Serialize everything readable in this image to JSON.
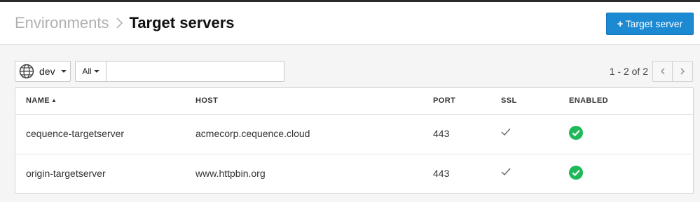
{
  "header": {
    "breadcrumb_parent": "Environments",
    "title": "Target servers",
    "add_button_plus": "+",
    "add_button_label": "Target server"
  },
  "toolbar": {
    "environment": "dev",
    "filter_type": "All",
    "filter_value": "",
    "page_info": "1 - 2 of 2"
  },
  "table": {
    "columns": {
      "name": "NAME",
      "host": "HOST",
      "port": "PORT",
      "ssl": "SSL",
      "enabled": "ENABLED"
    },
    "sort": {
      "column": "name",
      "direction": "ascending"
    },
    "rows": [
      {
        "name": "cequence-targetserver",
        "host": "acmecorp.cequence.cloud",
        "port": "443",
        "ssl": true,
        "enabled": true
      },
      {
        "name": "origin-targetserver",
        "host": "www.httpbin.org",
        "port": "443",
        "ssl": true,
        "enabled": true
      }
    ]
  },
  "colors": {
    "primary_button": "#1b8ad3",
    "enabled_green": "#1fb85a",
    "breadcrumb_parent": "#b0b0b0",
    "top_bar": "#2b2b2b"
  },
  "icons": {
    "breadcrumb_separator": "chevron-right-icon",
    "environment": "globe-icon",
    "sort": "sort-ascending-icon",
    "ssl": "checkmark-icon",
    "enabled": "check-circle-icon",
    "prev_page": "chevron-left-icon",
    "next_page": "chevron-right-icon"
  }
}
